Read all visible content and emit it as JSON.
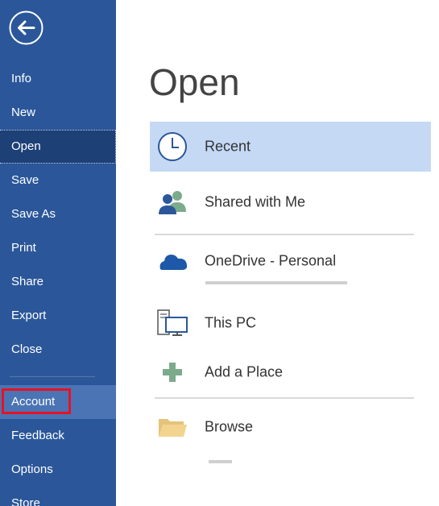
{
  "nav": {
    "back_label": "Back",
    "items": [
      {
        "label": "Info"
      },
      {
        "label": "New"
      },
      {
        "label": "Open"
      },
      {
        "label": "Save"
      },
      {
        "label": "Save As"
      },
      {
        "label": "Print"
      },
      {
        "label": "Share"
      },
      {
        "label": "Export"
      },
      {
        "label": "Close"
      }
    ],
    "lower_items": [
      {
        "label": "Account"
      },
      {
        "label": "Feedback"
      },
      {
        "label": "Options"
      },
      {
        "label": "Store"
      }
    ]
  },
  "main": {
    "title": "Open",
    "locations": [
      {
        "label": "Recent",
        "icon": "clock-icon"
      },
      {
        "label": "Shared with Me",
        "icon": "people-icon"
      },
      {
        "label": "OneDrive - Personal",
        "icon": "cloud-icon"
      },
      {
        "label": "This PC",
        "icon": "computer-icon"
      },
      {
        "label": "Add a Place",
        "icon": "plus-icon"
      },
      {
        "label": "Browse",
        "icon": "folder-icon"
      }
    ]
  },
  "colors": {
    "sidebar": "#2b579a",
    "sidebar_selected": "#1d4077",
    "highlight": "#c5d9f5",
    "annotation": "#e81123"
  }
}
